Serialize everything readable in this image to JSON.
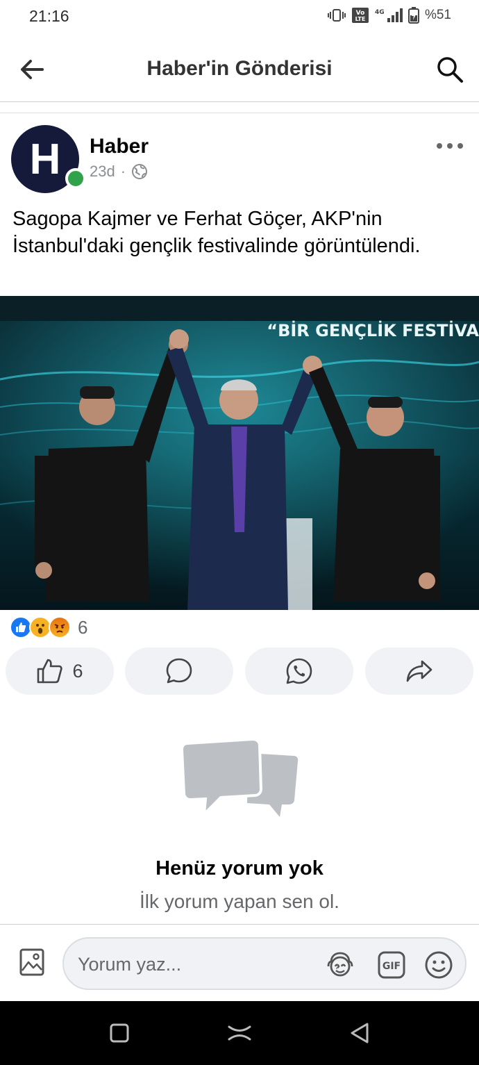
{
  "status_bar": {
    "time": "21:16",
    "network": "4G",
    "volte": "Vo LTE",
    "battery": "%51",
    "icons": [
      "vibrate-icon",
      "volte-icon",
      "signal-icon",
      "battery-icon"
    ]
  },
  "header": {
    "title": "Haber'in Gönderisi",
    "back_icon": "arrow-left-icon",
    "search_icon": "search-icon"
  },
  "post": {
    "page_name": "Haber",
    "avatar_letter": "H",
    "time_ago": "23d",
    "separator": "·",
    "privacy_icon": "globe-icon",
    "text": "Sagopa Kajmer ve Ferhat Göçer, AKP'nin İstanbul'daki gençlik festivalinde görüntülendi.",
    "image": {
      "banner_text": "“BİR GENÇLİK FESTİVA",
      "description_icon": "photo"
    },
    "reactions": {
      "types": [
        "like",
        "wow",
        "angry"
      ],
      "count": "6"
    },
    "actions": {
      "like_count": "6",
      "like_icon": "thumbs-up-icon",
      "comment_icon": "comment-icon",
      "whatsapp_icon": "whatsapp-icon",
      "share_icon": "share-icon"
    }
  },
  "comments": {
    "empty_title": "Henüz yorum yok",
    "empty_subtitle": "İlk yorum yapan sen ol."
  },
  "composer": {
    "placeholder": "Yorum yaz...",
    "gif_label": "GIF"
  },
  "colors": {
    "accent": "#1877f2",
    "online": "#31a24c",
    "avatar_bg": "#151a3b",
    "button_bg": "#f0f2f5"
  }
}
